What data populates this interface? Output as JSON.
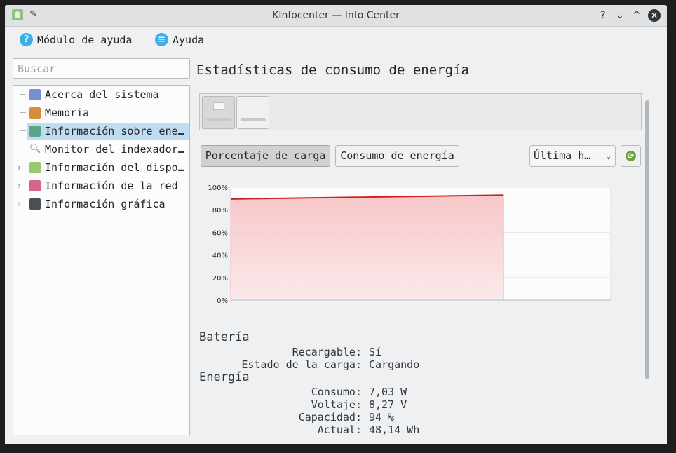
{
  "window": {
    "title": "KInfocenter — Info Center"
  },
  "titlebar": {
    "help": "?",
    "minimize": "⌄",
    "maximize": "^",
    "close": "✕"
  },
  "menubar": {
    "items": [
      {
        "label": "Módulo de ayuda",
        "icon": "help-circle-icon"
      },
      {
        "label": "Ayuda",
        "icon": "menu-icon"
      }
    ]
  },
  "sidebar": {
    "search_placeholder": "Buscar",
    "items": [
      {
        "label": "Acerca del sistema",
        "icon": "about-system-icon",
        "expandable": false,
        "selected": false,
        "icon_color": "#7a8ed6"
      },
      {
        "label": "Memoria",
        "icon": "memory-icon",
        "expandable": false,
        "selected": false,
        "icon_color": "#d98d3a"
      },
      {
        "label": "Información sobre ene…",
        "icon": "energy-icon",
        "expandable": false,
        "selected": true,
        "icon_color": "#5aa58c"
      },
      {
        "label": "Monitor del indexador…",
        "icon": "indexer-magnifier-icon",
        "expandable": false,
        "selected": false,
        "icon_color": "#5e6369"
      },
      {
        "label": "Información del dispo…",
        "icon": "device-info-icon",
        "expandable": true,
        "selected": false,
        "icon_color": "#9cc96f"
      },
      {
        "label": "Información de la red",
        "icon": "network-icon",
        "expandable": true,
        "selected": false,
        "icon_color": "#d4668a"
      },
      {
        "label": "Información gráfica",
        "icon": "graphics-icon",
        "expandable": true,
        "selected": false,
        "icon_color": "#4a4f55"
      }
    ]
  },
  "main": {
    "title": "Estadísticas de consumo de energía",
    "devices": [
      {
        "name": "ac-adapter-device",
        "charge_fraction": null,
        "active": true
      },
      {
        "name": "battery-device",
        "charge_fraction": 0.7,
        "active": false
      }
    ],
    "tabs": {
      "charge_percent": "Porcentaje de carga",
      "power_consumption": "Consumo de energía"
    },
    "time_range": {
      "selected": "Última h…"
    },
    "refresh_icon": "refresh-icon"
  },
  "chart_data": {
    "type": "area",
    "title": "",
    "xlabel": "",
    "ylabel": "",
    "ylim": [
      0,
      100
    ],
    "yticks": [
      "100%",
      "80%",
      "60%",
      "40%",
      "20%",
      "0%"
    ],
    "x_fraction_end_of_data": 0.718,
    "series": [
      {
        "x": [
          0,
          1
        ],
        "values": [
          89.5,
          93
        ],
        "color": "#d21f1f",
        "fill": "#f7c7c9"
      }
    ]
  },
  "details": {
    "battery": {
      "heading": "Batería",
      "rows": [
        {
          "label": "Recargable:",
          "value": "Sí"
        },
        {
          "label": "Estado de la carga:",
          "value": "Cargando"
        }
      ]
    },
    "energy": {
      "heading": "Energía",
      "rows": [
        {
          "label": "Consumo:",
          "value": "7,03 W"
        },
        {
          "label": "Voltaje:",
          "value": "8,27 V"
        },
        {
          "label": "Capacidad:",
          "value": "94 %"
        },
        {
          "label": "Actual:",
          "value": "48,14 Wh"
        }
      ]
    }
  }
}
